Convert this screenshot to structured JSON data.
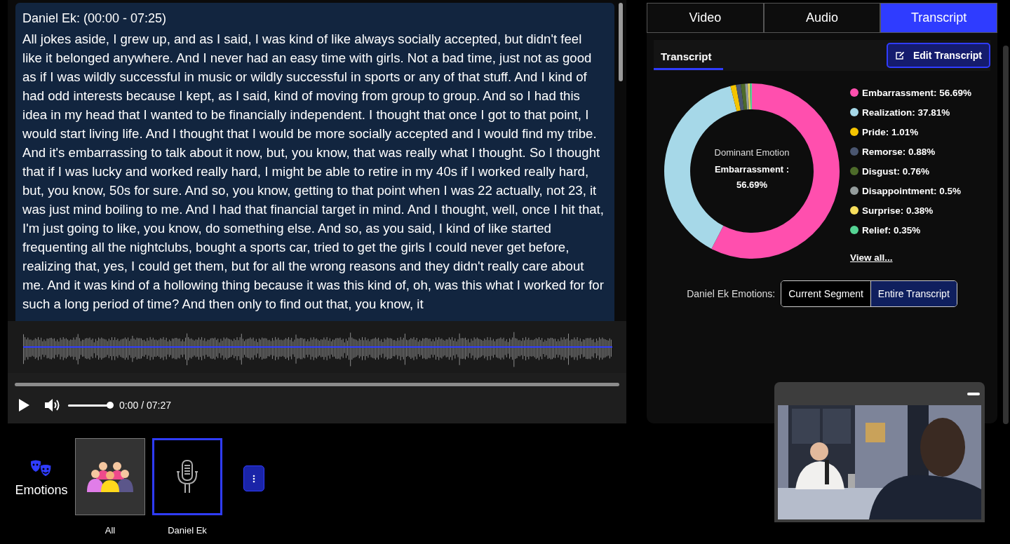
{
  "transcript": {
    "speaker_heading": "Daniel Ek: (00:00 - 07:25)",
    "text": "All jokes aside, I grew up, and as I said, I was kind of like always socially accepted, but didn't feel like it belonged anywhere. And I never had an easy time with girls. Not a bad time, just not as good as if I was wildly successful in music or wildly successful in sports or any of that stuff. And I kind of had odd interests because I kept, as I said, kind of moving from group to group. And so I had this idea in my head that I wanted to be financially independent. I thought that once I got to that point, I would start living life. And I thought that I would be more socially accepted and I would find my tribe. And it's embarrassing to talk about it now, but, you know, that was really what I thought. So I thought that if I was lucky and worked really hard, I might be able to retire in my 40s if I worked really hard, but, you know, 50s for sure. And so, you know, getting to that point when I was 22 actually, not 23, it was just mind boiling to me. And I had that financial target in mind. And I thought, well, once I hit that, I'm just going to like, you know, do something else. And so, as you said, I kind of like started frequenting all the nightclubs, bought a sports car, tried to get the girls I could never get before, realizing that, yes, I could get them, but for all the wrong reasons and they didn't really care about me. And it was kind of a hollowing thing because it was this kind of, oh, was this what I worked for for such a long period of time? And then only to find out that, you know, it"
  },
  "player": {
    "progress": {
      "level": 0.0
    },
    "volume": {
      "level": 1.0
    },
    "time": "0:00 / 07:27"
  },
  "emotions_bar": {
    "label": "Emotions",
    "speakers": [
      {
        "name": "All",
        "kind": "group",
        "selected": false
      },
      {
        "name": "Daniel Ek",
        "kind": "mic",
        "selected": true
      }
    ]
  },
  "tabs": [
    {
      "label": "Video",
      "selected": false
    },
    {
      "label": "Audio",
      "selected": false
    },
    {
      "label": "Transcript",
      "selected": true
    }
  ],
  "subheader": {
    "tab": "Transcript",
    "edit_button": "Edit Transcript"
  },
  "emotion_chart": {
    "center_caption": "Dominant Emotion",
    "center_value": "Embarrassment : 56.69%",
    "chart_data": {
      "type": "donut",
      "categories": [
        "Embarrassment: 56.69%",
        "Realization: 37.81%",
        "Pride: 1.01%",
        "Remorse: 0.88%",
        "Disgust: 0.76%",
        "Disappointment: 0.5%",
        "Surprise: 0.38%",
        "Relief: 0.35%"
      ],
      "series": [
        {
          "values": [
            56.69,
            37.81,
            1.01,
            0.88,
            0.76,
            0.5,
            0.38,
            0.35
          ]
        }
      ]
    },
    "legend": [
      {
        "color": "#ff4fae"
      },
      {
        "color": "#a6d8e8"
      },
      {
        "color": "#f5c400"
      },
      {
        "color": "#4a5670"
      },
      {
        "color": "#4d6b2a"
      },
      {
        "color": "#949c9c"
      },
      {
        "color": "#f7de5c"
      },
      {
        "color": "#55d494"
      }
    ],
    "view_all": "View all...",
    "scope_label": "Daniel Ek Emotions:",
    "scope_options": [
      {
        "label": "Current Segment",
        "selected": false
      },
      {
        "label": "Entire Transcript",
        "selected": true
      }
    ]
  }
}
